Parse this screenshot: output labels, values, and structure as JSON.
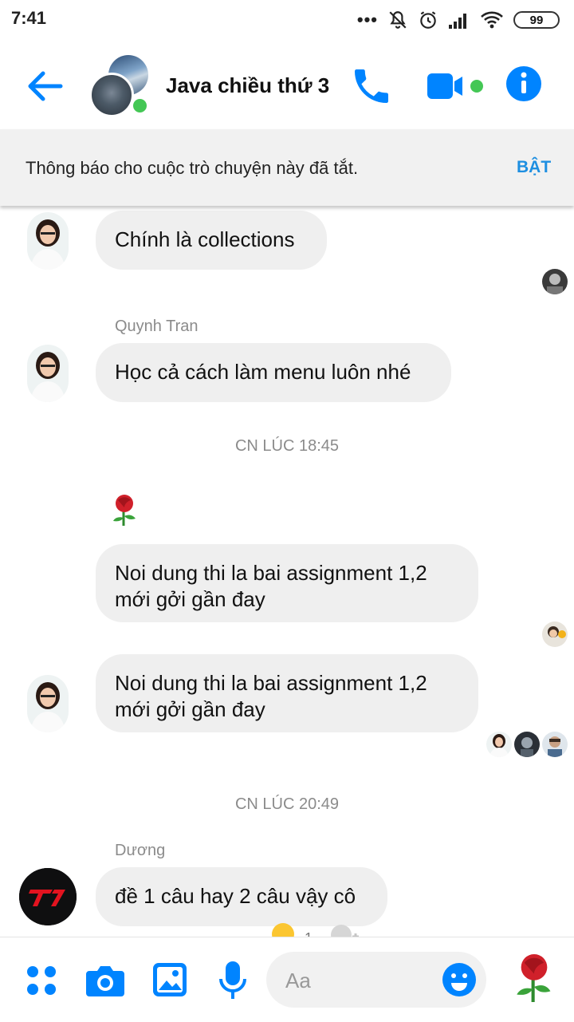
{
  "status_bar": {
    "time": "7:41",
    "battery": "99"
  },
  "header": {
    "title": "Java chiều thứ 3"
  },
  "notice": {
    "text": "Thông báo cho cuộc trò chuyện này đã tắt.",
    "action": "BẬT"
  },
  "messages": [
    {
      "text": "Chính là collections"
    },
    {
      "sender": "Quynh Tran",
      "text": "Học cả cách làm menu luôn nhé"
    },
    {
      "timestamp": "CN LÚC 18:45"
    },
    {
      "text": "Noi dung thi la bai assignment 1,2 mới gởi gần đay"
    },
    {
      "text": "Noi dung thi la bai assignment 1,2 mới gởi gần đay"
    },
    {
      "timestamp": "CN LÚC 20:49"
    },
    {
      "sender": "Dương",
      "text": "đề 1 câu hay 2 câu vậy cô",
      "reactions": [
        "1"
      ]
    }
  ],
  "composer": {
    "placeholder": "Aa"
  },
  "colors": {
    "accent": "#0084ff",
    "online": "#44c755",
    "bubble": "#efefef"
  }
}
